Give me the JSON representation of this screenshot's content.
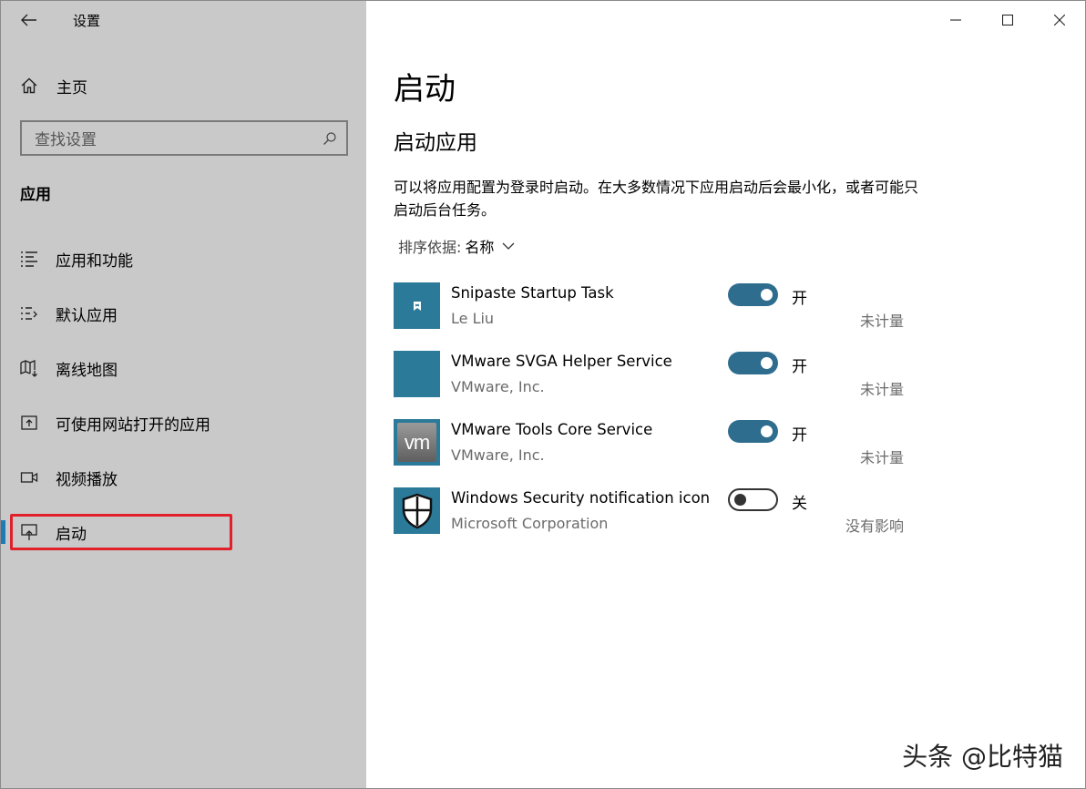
{
  "window": {
    "title": "设置"
  },
  "sidebar": {
    "home_label": "主页",
    "search_placeholder": "查找设置",
    "section_title": "应用",
    "items": [
      {
        "label": "应用和功能",
        "icon": "apps-features-icon"
      },
      {
        "label": "默认应用",
        "icon": "default-apps-icon"
      },
      {
        "label": "离线地图",
        "icon": "offline-maps-icon"
      },
      {
        "label": "可使用网站打开的应用",
        "icon": "apps-for-websites-icon"
      },
      {
        "label": "视频播放",
        "icon": "video-playback-icon"
      },
      {
        "label": "启动",
        "icon": "startup-icon",
        "active": true
      }
    ]
  },
  "main": {
    "page_title": "启动",
    "sub_title": "启动应用",
    "description": "可以将应用配置为登录时启动。在大多数情况下应用启动后会最小化，或者可能只启动后台任务。",
    "sort_label": "排序依据:",
    "sort_value": "名称",
    "apps": [
      {
        "name": "Snipaste Startup Task",
        "publisher": "Le Liu",
        "state": "开",
        "on": true,
        "impact": "未计量"
      },
      {
        "name": "VMware SVGA Helper Service",
        "publisher": "VMware, Inc.",
        "state": "开",
        "on": true,
        "impact": "未计量"
      },
      {
        "name": "VMware Tools Core Service",
        "publisher": "VMware, Inc.",
        "state": "开",
        "on": true,
        "impact": "未计量",
        "icon_text": "vm"
      },
      {
        "name": "Windows Security notification icon",
        "publisher": "Microsoft Corporation",
        "state": "关",
        "on": false,
        "impact": "没有影响"
      }
    ]
  },
  "watermark": "头条 @比特猫",
  "colors": {
    "sidebar_bg": "#c9c9c9",
    "accent": "#1f7bb8",
    "toggle_on": "#2e6d8e",
    "app_tile": "#2b7a99",
    "highlight": "#e0202a"
  }
}
